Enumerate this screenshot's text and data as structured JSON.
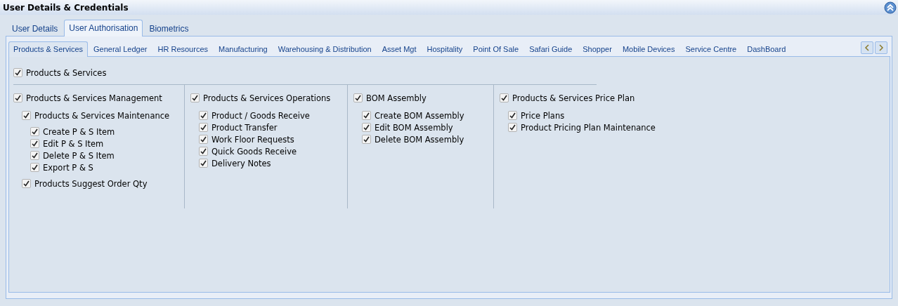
{
  "window": {
    "title": "User Details & Credentials"
  },
  "tabs": [
    {
      "label": "User Details",
      "selected": false
    },
    {
      "label": "User Authorisation",
      "selected": true
    },
    {
      "label": "Biometrics",
      "selected": false
    }
  ],
  "module_tabs": [
    {
      "label": "Products & Services",
      "selected": true
    },
    {
      "label": "General Ledger",
      "selected": false
    },
    {
      "label": "HR Resources",
      "selected": false
    },
    {
      "label": "Manufacturing",
      "selected": false
    },
    {
      "label": "Warehousing & Distribution",
      "selected": false
    },
    {
      "label": "Asset Mgt",
      "selected": false
    },
    {
      "label": "Hospitality",
      "selected": false
    },
    {
      "label": "Point Of Sale",
      "selected": false
    },
    {
      "label": "Safari Guide",
      "selected": false
    },
    {
      "label": "Shopper",
      "selected": false
    },
    {
      "label": "Mobile Devices",
      "selected": false
    },
    {
      "label": "Service Centre",
      "selected": false
    },
    {
      "label": "DashBoard",
      "selected": false
    }
  ],
  "root": {
    "label": "Products & Services",
    "checked": true
  },
  "columns": [
    {
      "label": "Products & Services Management",
      "checked": true,
      "children": [
        {
          "label": "Products & Services Maintenance",
          "checked": true,
          "children": [
            {
              "label": "Create P & S Item",
              "checked": true
            },
            {
              "label": "Edit P & S Item",
              "checked": true
            },
            {
              "label": "Delete P & S Item",
              "checked": true
            },
            {
              "label": "Export P & S",
              "checked": true
            }
          ]
        },
        {
          "label": "Products Suggest Order Qty",
          "checked": true
        }
      ]
    },
    {
      "label": "Products & Services Operations",
      "checked": true,
      "children": [
        {
          "label": "Product / Goods Receive",
          "checked": true
        },
        {
          "label": "Product Transfer",
          "checked": true
        },
        {
          "label": "Work Floor Requests",
          "checked": true
        },
        {
          "label": "Quick Goods Receive",
          "checked": true
        },
        {
          "label": "Delivery Notes",
          "checked": true
        }
      ]
    },
    {
      "label": "BOM Assembly",
      "checked": true,
      "children": [
        {
          "label": "Create BOM Assembly",
          "checked": true
        },
        {
          "label": "Edit BOM Assembly",
          "checked": true
        },
        {
          "label": "Delete BOM Assembly",
          "checked": true
        }
      ]
    },
    {
      "label": "Products & Services Price Plan",
      "checked": true,
      "children": [
        {
          "label": "Price Plans",
          "checked": true
        },
        {
          "label": "Product Pricing Plan Maintenance",
          "checked": true
        }
      ]
    }
  ]
}
